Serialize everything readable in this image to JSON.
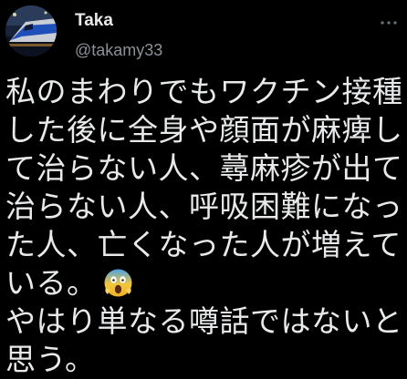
{
  "author": {
    "display_name": "Taka",
    "handle": "@takamy33",
    "avatar_icon": "train-avatar-icon"
  },
  "actions": {
    "more_icon": "more-dots-icon"
  },
  "tweet": {
    "lines": [
      "私のまわりでもワクチン接種",
      "した後に全身や顔面が麻痺し",
      "て治らない人、蕁麻疹が出て",
      "治らない人、呼吸困難になっ",
      "た人、亡くなった人が増えて",
      "いる。",
      "やはり単なる噂話ではないと",
      "思う。"
    ],
    "emoji": "face-screaming-in-fear-emoji"
  },
  "colors": {
    "background": "#000000",
    "text": "#e7e9ea",
    "secondary_text": "#8b9096"
  }
}
